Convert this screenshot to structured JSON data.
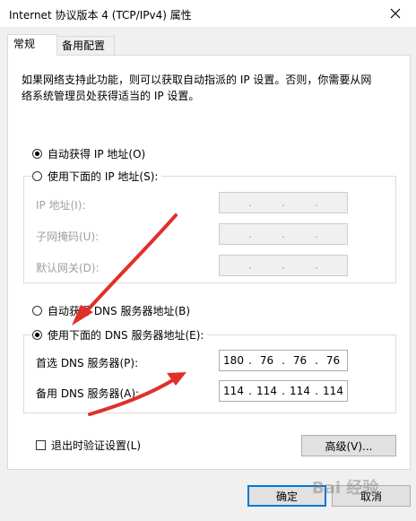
{
  "window": {
    "title": "Internet 协议版本 4 (TCP/IPv4) 属性"
  },
  "tabs": [
    {
      "label": "常规"
    },
    {
      "label": "备用配置"
    }
  ],
  "description": {
    "line1": "如果网络支持此功能，则可以获取自动指派的 IP 设置。否则，你需要从网",
    "line2": "络系统管理员处获得适当的 IP 设置。"
  },
  "ip": {
    "auto_label": "自动获得 IP 地址(O)",
    "manual_label": "使用下面的 IP 地址(S):",
    "address_label": "IP 地址(I):",
    "subnet_label": "子网掩码(U):",
    "gateway_label": "默认网关(D):"
  },
  "dns": {
    "auto_label": "自动获得 DNS 服务器地址(B)",
    "manual_label": "使用下面的 DNS 服务器地址(E):",
    "preferred_label": "首选 DNS 服务器(P):",
    "alternate_label": "备用 DNS 服务器(A):",
    "preferred": [
      "180",
      "76",
      "76",
      "76"
    ],
    "alternate": [
      "114",
      "114",
      "114",
      "114"
    ]
  },
  "validate_label": "退出时验证设置(L)",
  "advanced_label": "高级(V)...",
  "ok_label": "确定",
  "cancel_label": "取消",
  "colors": {
    "accent": "#0078d7",
    "arrow": "#e0302a"
  }
}
